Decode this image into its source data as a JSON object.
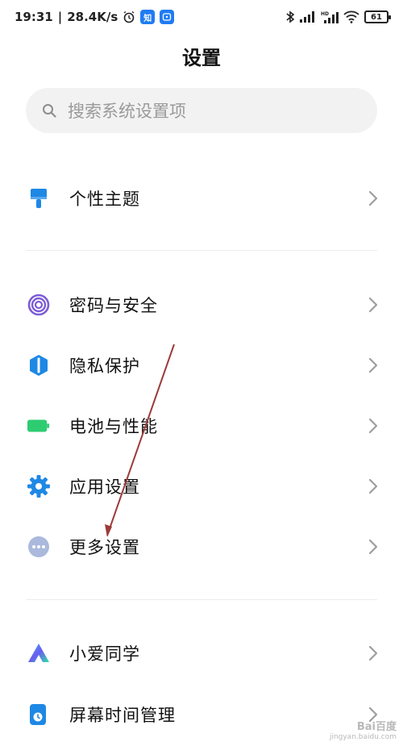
{
  "status_bar": {
    "time": "19:31",
    "network_speed": "28.4K/s",
    "app_badge_1": "知",
    "battery_level": "61",
    "icons": [
      "alarm-icon",
      "bluetooth-icon",
      "signal-icon",
      "hd-signal-icon",
      "wifi-icon",
      "battery-icon"
    ]
  },
  "header": {
    "title": "设置"
  },
  "search": {
    "placeholder": "搜索系统设置项"
  },
  "settings_groups": [
    [
      {
        "label": "个性主题",
        "icon": "theme-brush-icon",
        "color": "#1e88e5"
      }
    ],
    [
      {
        "label": "密码与安全",
        "icon": "fingerprint-icon",
        "color": "#7c5cd6"
      },
      {
        "label": "隐私保护",
        "icon": "privacy-shield-icon",
        "color": "#1e88e5"
      },
      {
        "label": "电池与性能",
        "icon": "battery-icon",
        "color": "#2ecc71"
      },
      {
        "label": "应用设置",
        "icon": "gear-icon",
        "color": "#1e88e5"
      },
      {
        "label": "更多设置",
        "icon": "more-dots-icon",
        "color": "#8aa4d6"
      }
    ],
    [
      {
        "label": "小爱同学",
        "icon": "xiaoai-icon",
        "color": "#6a5cf0"
      },
      {
        "label": "屏幕时间管理",
        "icon": "screen-time-icon",
        "color": "#1e88e5"
      }
    ]
  ],
  "annotation_arrow_color": "#9c3a3a",
  "watermark": {
    "text": "Bai百度",
    "url_text": "jingyan.baidu.com"
  }
}
